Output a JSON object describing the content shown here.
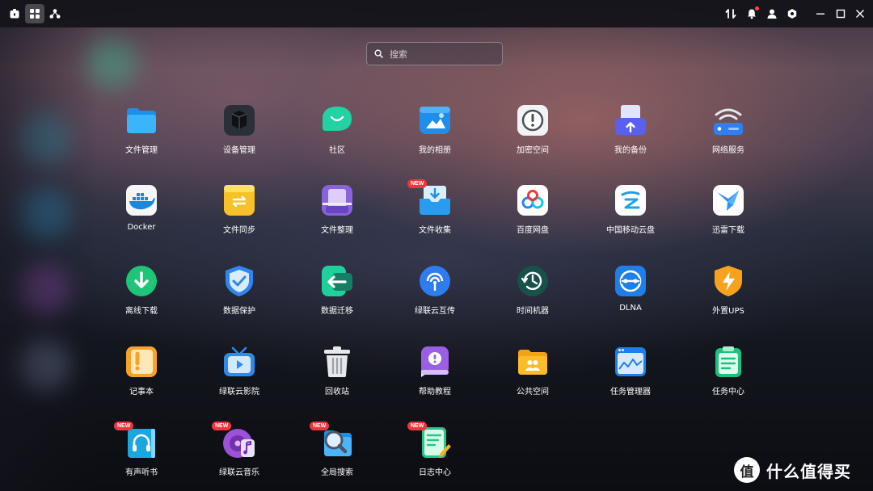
{
  "search": {
    "placeholder": "搜索"
  },
  "apps": [
    {
      "label": "文件管理",
      "icon": "folder-icon"
    },
    {
      "label": "设备管理",
      "icon": "device-box-icon"
    },
    {
      "label": "社区",
      "icon": "community-chat-icon"
    },
    {
      "label": "我的相册",
      "icon": "photo-album-icon"
    },
    {
      "label": "加密空间",
      "icon": "encrypted-space-icon"
    },
    {
      "label": "我的备份",
      "icon": "backup-icon"
    },
    {
      "label": "网络服务",
      "icon": "network-service-icon"
    },
    {
      "label": "Docker",
      "icon": "docker-icon"
    },
    {
      "label": "文件同步",
      "icon": "file-sync-icon"
    },
    {
      "label": "文件整理",
      "icon": "file-organize-icon"
    },
    {
      "label": "文件收集",
      "icon": "file-collect-icon",
      "badge": "NEW"
    },
    {
      "label": "百度网盘",
      "icon": "baidu-netdisk-icon"
    },
    {
      "label": "中国移动云盘",
      "icon": "china-mobile-cloud-icon"
    },
    {
      "label": "迅雷下载",
      "icon": "xunlei-download-icon"
    },
    {
      "label": "离线下载",
      "icon": "offline-download-icon"
    },
    {
      "label": "数据保护",
      "icon": "data-protection-shield-icon"
    },
    {
      "label": "数据迁移",
      "icon": "data-migration-icon"
    },
    {
      "label": "绿联云互传",
      "icon": "transfer-icon"
    },
    {
      "label": "时间机器",
      "icon": "time-machine-icon"
    },
    {
      "label": "DLNA",
      "icon": "dlna-icon"
    },
    {
      "label": "外置UPS",
      "icon": "ups-icon"
    },
    {
      "label": "记事本",
      "icon": "notepad-icon"
    },
    {
      "label": "绿联云影院",
      "icon": "tv-cinema-icon"
    },
    {
      "label": "回收站",
      "icon": "trash-icon"
    },
    {
      "label": "帮助教程",
      "icon": "help-tutorial-icon"
    },
    {
      "label": "公共空间",
      "icon": "public-space-folder-icon"
    },
    {
      "label": "任务管理器",
      "icon": "task-manager-icon"
    },
    {
      "label": "任务中心",
      "icon": "task-center-icon"
    },
    {
      "label": "有声听书",
      "icon": "audiobook-icon",
      "badge": "NEW"
    },
    {
      "label": "绿联云音乐",
      "icon": "music-icon",
      "badge": "NEW"
    },
    {
      "label": "全局搜索",
      "icon": "global-search-icon",
      "badge": "NEW"
    },
    {
      "label": "日志中心",
      "icon": "log-center-icon",
      "badge": "NEW"
    }
  ],
  "watermark": {
    "text": "什么值得买",
    "logo_char": "值"
  },
  "colors": {
    "badge": "#f0353e",
    "topbar": "#121218",
    "accent_green": "#23c97a"
  }
}
